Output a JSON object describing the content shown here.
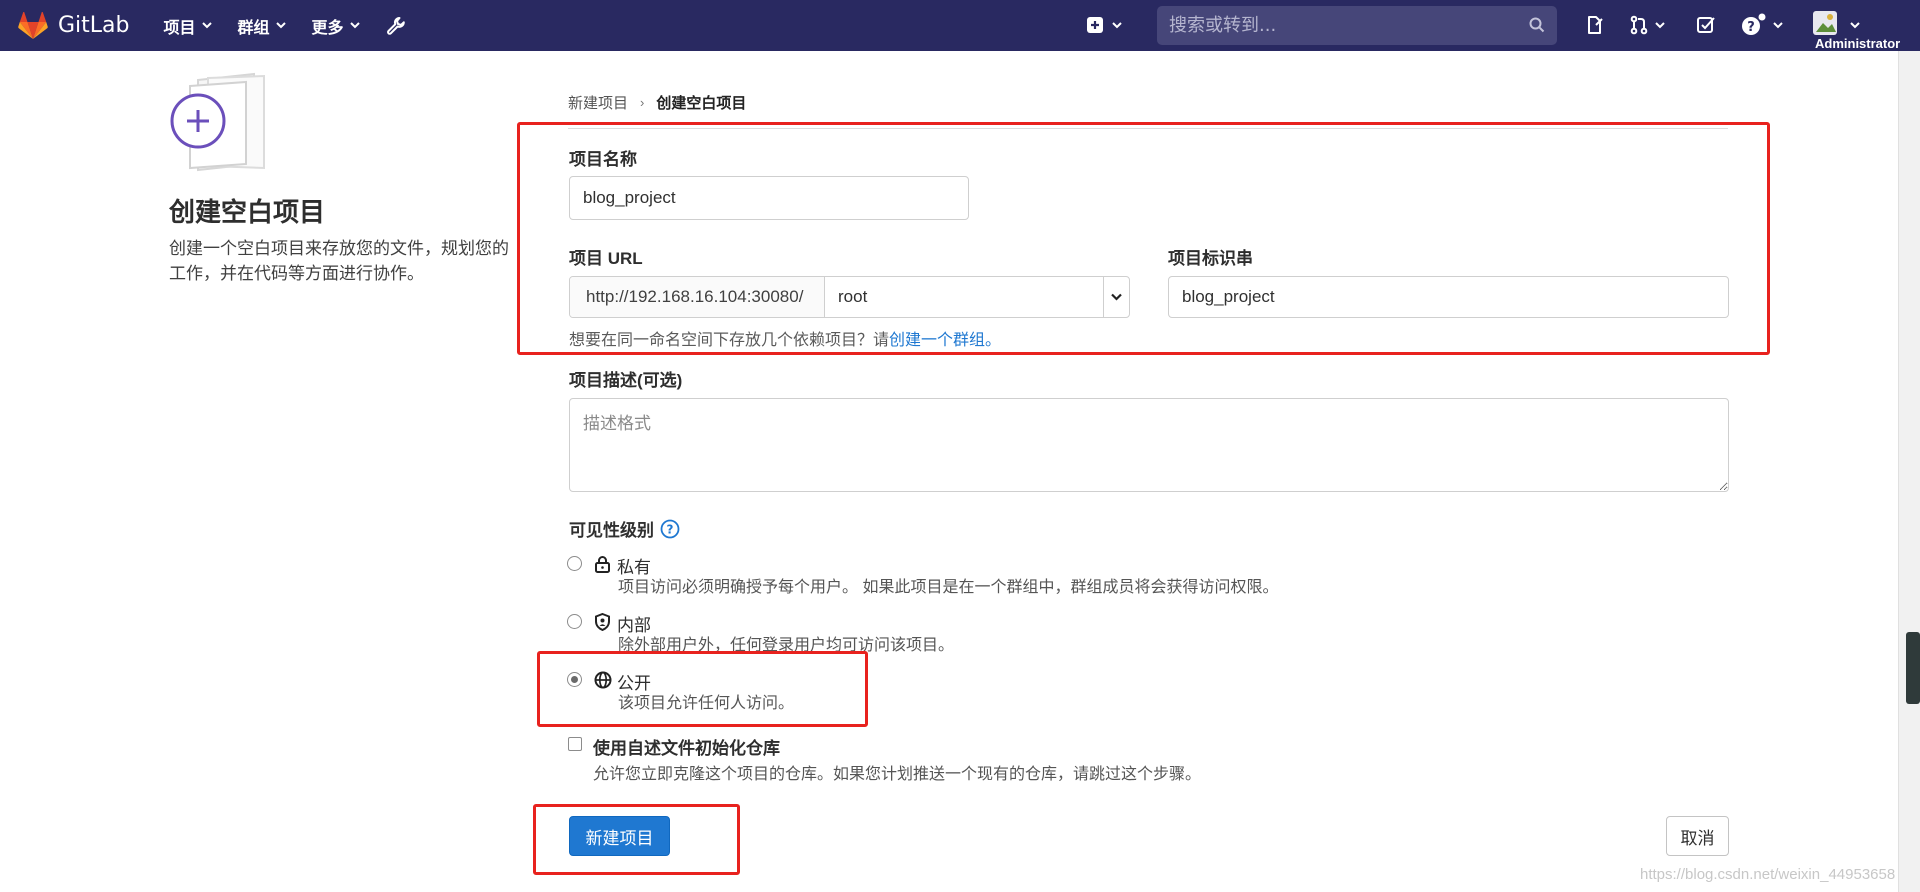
{
  "app": {
    "name": "GitLab",
    "brand_color": "#292961",
    "accent_color": "#1f78d1",
    "logo_icon": "gitlab-tanuki-icon"
  },
  "nav": {
    "menu": [
      {
        "label": "项目"
      },
      {
        "label": "群组"
      },
      {
        "label": "更多"
      }
    ],
    "admin_icon": "wrench-icon",
    "search": {
      "placeholder": "搜索或转到..."
    },
    "right_icons": [
      "plus-square-icon",
      "issues-icon",
      "merge-request-icon",
      "todo-icon",
      "help-icon"
    ],
    "user": {
      "name": "Administrator"
    }
  },
  "left": {
    "title": "创建空白项目",
    "description_line1": "创建一个空白项目来存放您的文件，规划您的",
    "description_line2": "工作，并在代码等方面进行协作。"
  },
  "breadcrumb": {
    "parent": "新建项目",
    "current": "创建空白项目"
  },
  "form": {
    "name_label": "项目名称",
    "name_value": "blog_project",
    "url_label": "项目 URL",
    "url_prefix": "http://192.168.16.104:30080/",
    "namespace_value": "root",
    "slug_label": "项目标识串",
    "slug_value": "blog_project",
    "group_hint": "想要在同一命名空间下存放几个依赖项目？请",
    "group_hint_link": "创建一个群组。",
    "desc_label": "项目描述(可选)",
    "desc_placeholder": "描述格式",
    "visibility_label": "可见性级别",
    "visibility_options": [
      {
        "title": "私有",
        "desc": "项目访问必须明确授予每个用户。 如果此项目是在一个群组中，群组成员将会获得访问权限。",
        "icon": "lock-icon",
        "selected": false
      },
      {
        "title": "内部",
        "desc": "除外部用户外，任何登录用户均可访问该项目。",
        "icon": "shield-icon",
        "selected": false
      },
      {
        "title": "公开",
        "desc": "该项目允许任何人访问。",
        "icon": "globe-icon",
        "selected": true
      }
    ],
    "readme_title": "使用自述文件初始化仓库",
    "readme_desc": "允许您立即克隆这个项目的仓库。如果您计划推送一个现有的仓库，请跳过这个步骤。",
    "readme_checked": false,
    "submit_label": "新建项目",
    "cancel_label": "取消"
  },
  "annotation_color": "#e8221e",
  "watermark": "https://blog.csdn.net/weixin_44953658"
}
